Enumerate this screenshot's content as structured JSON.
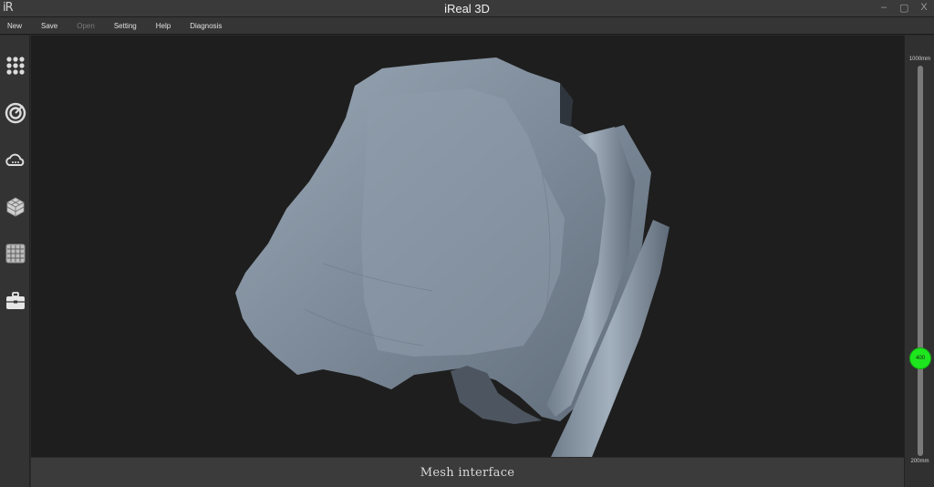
{
  "window": {
    "logo": "iR",
    "title": "iReal 3D",
    "controls": {
      "minimize": "–",
      "restore": "▢",
      "close": "X"
    }
  },
  "menu": {
    "new": "New",
    "save": "Save",
    "open": "Open",
    "setting": "Setting",
    "help": "Help",
    "diagnosis": "Diagnosis"
  },
  "toolbar": {
    "icons": [
      "grid-dots-icon",
      "target-icon",
      "cloud-icon",
      "mesh-cube-icon",
      "grid-panel-icon",
      "toolbox-icon"
    ]
  },
  "status": {
    "text": "Mesh interface"
  },
  "distance_slider": {
    "max_label": "1000mm",
    "min_label": "200mm",
    "value": 400,
    "value_label": "400",
    "min": 200,
    "max": 1000
  },
  "colors": {
    "accent": "#1ee61e",
    "mesh": "#7f8d9c",
    "viewport": "#1e1e1e"
  }
}
